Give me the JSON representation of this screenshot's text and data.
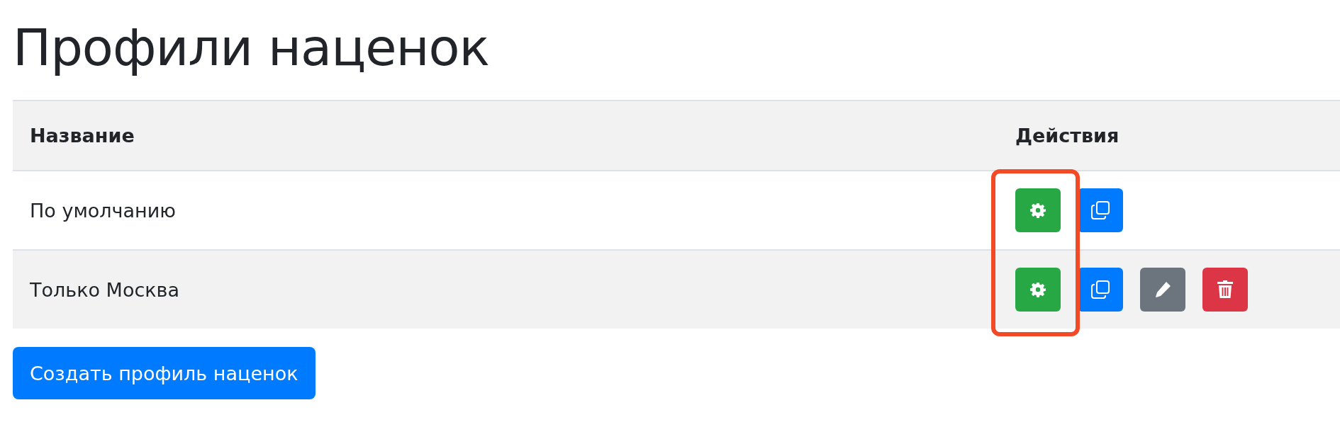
{
  "title": "Профили наценок",
  "table": {
    "columns": [
      "Название",
      "Действия"
    ],
    "rows": [
      {
        "name": "По умолчанию",
        "actions": [
          {
            "kind": "settings"
          },
          {
            "kind": "copy"
          }
        ]
      },
      {
        "name": "Только Москва",
        "actions": [
          {
            "kind": "settings"
          },
          {
            "kind": "copy"
          },
          {
            "kind": "edit"
          },
          {
            "kind": "delete"
          }
        ]
      }
    ]
  },
  "highlight_settings_column": true,
  "create_button": "Создать профиль наценок"
}
